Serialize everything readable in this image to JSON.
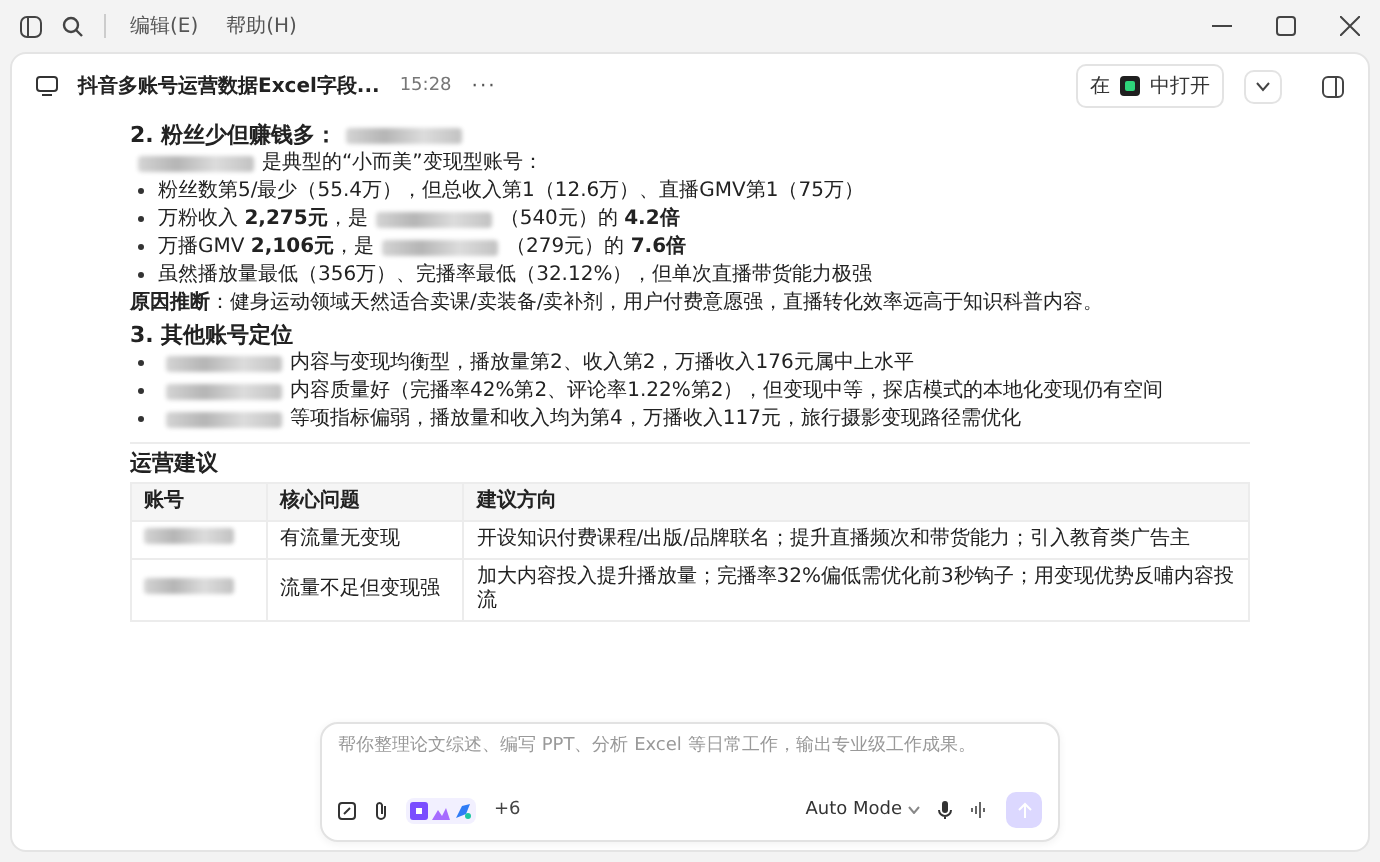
{
  "menu": [
    {
      "label": "编辑(E)"
    },
    {
      "label": "帮助(H)"
    }
  ],
  "chat": {
    "title": "抖音多账号运营数据Excel字段...",
    "time": "15:28",
    "more": "···",
    "open_in": {
      "prefix": "在",
      "suffix": "中打开"
    }
  },
  "sections": [
    {
      "heading": [
        {
          "kind": "text",
          "text": "2. 粉丝少但赚钱多："
        },
        {
          "kind": "redacted"
        }
      ],
      "blocks": [
        {
          "kind": "para",
          "segments": [
            {
              "kind": "redacted"
            },
            {
              "kind": "text",
              "text": "是典型的“小而美”变现型账号："
            }
          ]
        },
        {
          "kind": "bullet",
          "segments": [
            {
              "kind": "text",
              "text": "粉丝数第5/最少（55.4万），但总收入第1（12.6万）、直播GMV第1（75万）"
            }
          ]
        },
        {
          "kind": "bullet",
          "segments": [
            {
              "kind": "text",
              "text": "万粉收入 **2,275元**，是"
            },
            {
              "kind": "redacted"
            },
            {
              "kind": "text",
              "text": "（540元）的 **4.2倍**"
            }
          ]
        },
        {
          "kind": "bullet",
          "segments": [
            {
              "kind": "text",
              "text": "万播GMV **2,106元**，是"
            },
            {
              "kind": "redacted"
            },
            {
              "kind": "text",
              "text": "（279元）的 **7.6倍**"
            }
          ]
        },
        {
          "kind": "bullet",
          "segments": [
            {
              "kind": "text",
              "text": "虽然播放量最低（356万）、完播率最低（32.12%），但单次直播带货能力极强"
            }
          ]
        },
        {
          "kind": "para",
          "segments": [
            {
              "kind": "text",
              "text": "**原因推断**：健身运动领域天然适合卖课/卖装备/卖补剂，用户付费意愿强，直播转化效率远高于知识科普内容。"
            }
          ]
        }
      ]
    },
    {
      "heading": [
        {
          "kind": "text",
          "text": "3. 其他账号定位"
        }
      ],
      "blocks": [
        {
          "kind": "bullet",
          "segments": [
            {
              "kind": "redacted"
            },
            {
              "kind": "text",
              "text": "内容与变现均衡型，播放量第2、收入第2，万播收入176元属中上水平"
            }
          ]
        },
        {
          "kind": "bullet",
          "segments": [
            {
              "kind": "redacted"
            },
            {
              "kind": "text",
              "text": "内容质量好（完播率42%第2、评论率1.22%第2），但变现中等，探店模式的本地化变现仍有空间"
            }
          ]
        },
        {
          "kind": "bullet",
          "segments": [
            {
              "kind": "redacted"
            },
            {
              "kind": "text",
              "text": "等项指标偏弱，播放量和收入均为第4，万播收入117元，旅行摄影变现路径需优化"
            }
          ]
        }
      ]
    }
  ],
  "advice": {
    "heading": "运营建议",
    "columns": [
      "账号",
      "核心问题",
      "建议方向"
    ],
    "rows": [
      {
        "account_redacted": true,
        "problem": "有流量无变现",
        "direction": "开设知识付费课程/出版/品牌联名；提升直播频次和带货能力；引入教育类广告主"
      },
      {
        "account_redacted": true,
        "problem": "流量不足但变现强",
        "direction": "加大内容投入提升播放量；完播率32%偏低需优化前3秒钩子；用变现优势反哺内容投流"
      }
    ]
  },
  "composer": {
    "placeholder": "帮你整理论文综述、编写 PPT、分析 Excel 等日常工作，输出专业级工作成果。",
    "more_tools": "+6",
    "mode": "Auto Mode",
    "send_disabled": true
  }
}
